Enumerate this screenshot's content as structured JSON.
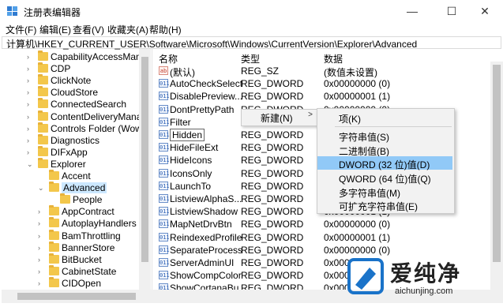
{
  "window": {
    "title": "注册表编辑器",
    "minimize_glyph": "—",
    "maximize_glyph": "☐",
    "close_glyph": "✕"
  },
  "menubar": [
    "文件(F)",
    "编辑(E)",
    "查看(V)",
    "收藏夹(A)",
    "帮助(H)"
  ],
  "address": "计算机\\HKEY_CURRENT_USER\\Software\\Microsoft\\Windows\\CurrentVersion\\Explorer\\Advanced",
  "tree": [
    {
      "label": "CapabilityAccessMana",
      "expand": ">"
    },
    {
      "label": "CDP",
      "expand": ">"
    },
    {
      "label": "ClickNote",
      "expand": ">"
    },
    {
      "label": "CloudStore",
      "expand": ">"
    },
    {
      "label": "ConnectedSearch",
      "expand": ">"
    },
    {
      "label": "ContentDeliveryManag",
      "expand": ">"
    },
    {
      "label": "Controls Folder (Wow6",
      "expand": ">"
    },
    {
      "label": "Diagnostics",
      "expand": ">"
    },
    {
      "label": "DIFxApp",
      "expand": ">"
    },
    {
      "label": "Explorer",
      "expand": "v"
    },
    {
      "label": "Accent",
      "expand": ""
    },
    {
      "label": "Advanced",
      "expand": "v"
    },
    {
      "label": "People",
      "expand": ""
    },
    {
      "label": "AppContract",
      "expand": ">"
    },
    {
      "label": "AutoplayHandlers",
      "expand": ">"
    },
    {
      "label": "BamThrottling",
      "expand": ">"
    },
    {
      "label": "BannerStore",
      "expand": ">"
    },
    {
      "label": "BitBucket",
      "expand": ">"
    },
    {
      "label": "CabinetState",
      "expand": ">"
    },
    {
      "label": "CIDOpen",
      "expand": ">"
    }
  ],
  "list": {
    "headers": {
      "name": "名称",
      "type": "类型",
      "data": "数据"
    },
    "rows": [
      {
        "icon": "ab",
        "name": "(默认)",
        "type": "REG_SZ",
        "data": "(数值未设置)"
      },
      {
        "icon": "011",
        "name": "AutoCheckSelect",
        "type": "REG_DWORD",
        "data": "0x00000000 (0)"
      },
      {
        "icon": "011",
        "name": "DisablePreview...",
        "type": "REG_DWORD",
        "data": "0x00000001 (1)"
      },
      {
        "icon": "011",
        "name": "DontPrettyPath",
        "type": "REG_DWORD",
        "data": "0x00000000 (0)"
      },
      {
        "icon": "011",
        "name": "Filter",
        "type": "",
        "data": ""
      },
      {
        "icon": "011",
        "name": "Hidden",
        "type": "REG_DWORD",
        "data": ""
      },
      {
        "icon": "011",
        "name": "HideFileExt",
        "type": "REG_DWORD",
        "data": ""
      },
      {
        "icon": "011",
        "name": "HideIcons",
        "type": "REG_DWORD",
        "data": ""
      },
      {
        "icon": "011",
        "name": "IconsOnly",
        "type": "REG_DWORD",
        "data": ""
      },
      {
        "icon": "011",
        "name": "LaunchTo",
        "type": "REG_DWORD",
        "data": ""
      },
      {
        "icon": "011",
        "name": "ListviewAlphaS...",
        "type": "REG_DWORD",
        "data": ""
      },
      {
        "icon": "011",
        "name": "ListviewShadow",
        "type": "REG_DWORD",
        "data": "0x00000001 (1)"
      },
      {
        "icon": "011",
        "name": "MapNetDrvBtn",
        "type": "REG_DWORD",
        "data": "0x00000000 (0)"
      },
      {
        "icon": "011",
        "name": "ReindexedProfile",
        "type": "REG_DWORD",
        "data": "0x00000001 (1)"
      },
      {
        "icon": "011",
        "name": "SeparateProcess",
        "type": "REG_DWORD",
        "data": "0x00000000 (0)"
      },
      {
        "icon": "011",
        "name": "ServerAdminUI",
        "type": "REG_DWORD",
        "data": "0x000"
      },
      {
        "icon": "011",
        "name": "ShowCompColor",
        "type": "REG_DWORD",
        "data": "0x000"
      },
      {
        "icon": "011",
        "name": "ShowCortanaBu",
        "type": "REG_DWORD",
        "data": "0x000"
      }
    ]
  },
  "context_menu": {
    "new_label": "新建(N)",
    "arrow": ">"
  },
  "submenu": {
    "items": [
      "项(K)",
      "字符串值(S)",
      "二进制值(B)",
      "DWORD (32 位)值(D)",
      "QWORD (64 位)值(Q)",
      "多字符串值(M)",
      "可扩充字符串值(E)"
    ],
    "highlighted": "DWORD (32 位)值(D)"
  },
  "watermark": {
    "title": "爱纯净",
    "url": "aichunjing.com"
  },
  "colors": {
    "selection": "#cce8ff",
    "menu_highlight": "#91c9f7",
    "folder": "#f3c74b"
  }
}
